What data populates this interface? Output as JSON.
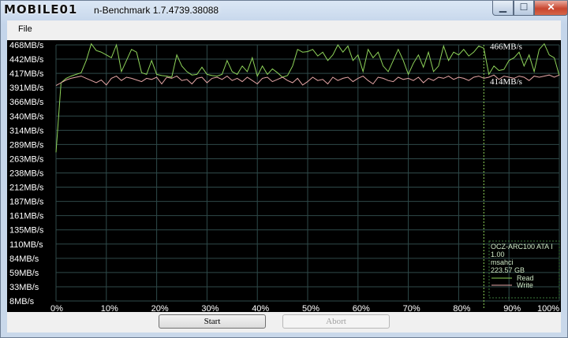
{
  "window": {
    "logo_text": "MOBILE01",
    "title": "n-Benchmark 1.7.4739.38088",
    "min_glyph": "▁",
    "max_glyph": "☐",
    "close_glyph": "✕"
  },
  "menu": {
    "file": "File"
  },
  "buttons": {
    "start": "Start",
    "abort": "Abort"
  },
  "device": {
    "lines": [
      "OCZ-ARC100 ATA I",
      "1.00",
      "msahci",
      "223.57 GB"
    ],
    "legend_read": "Read",
    "legend_write": "Write"
  },
  "chart_data": {
    "type": "line",
    "ylim": [
      8,
      468
    ],
    "y_ticks": [
      "468MB/s",
      "442MB/s",
      "417MB/s",
      "391MB/s",
      "366MB/s",
      "340MB/s",
      "314MB/s",
      "289MB/s",
      "263MB/s",
      "238MB/s",
      "212MB/s",
      "187MB/s",
      "161MB/s",
      "135MB/s",
      "110MB/s",
      "84MB/s",
      "59MB/s",
      "33MB/s",
      "8MB/s"
    ],
    "x_ticks": [
      "0%",
      "10%",
      "20%",
      "30%",
      "40%",
      "50%",
      "60%",
      "70%",
      "80%",
      "90%",
      "100%"
    ],
    "xlim": [
      0,
      100
    ],
    "grid": true,
    "progress_marker": 85,
    "series": [
      {
        "name": "Read",
        "color": "#8fd45a",
        "readout": "466MB/s",
        "x": [
          0,
          1,
          2,
          3,
          4,
          5,
          6,
          7,
          8,
          9,
          10,
          11,
          12,
          13,
          14,
          15,
          16,
          17,
          18,
          19,
          20,
          21,
          22,
          23,
          24,
          25,
          26,
          27,
          28,
          29,
          30,
          31,
          32,
          33,
          34,
          35,
          36,
          37,
          38,
          39,
          40,
          41,
          42,
          43,
          44,
          45,
          46,
          47,
          48,
          49,
          50,
          51,
          52,
          53,
          54,
          55,
          56,
          57,
          58,
          59,
          60,
          61,
          62,
          63,
          64,
          65,
          66,
          67,
          68,
          69,
          70,
          71,
          72,
          73,
          74,
          75,
          76,
          77,
          78,
          79,
          80,
          81,
          82,
          83,
          84,
          85,
          86,
          87,
          88,
          89,
          90,
          91,
          92,
          93,
          94,
          95,
          96,
          97,
          98,
          99,
          100
        ],
        "y": [
          275,
          400,
          408,
          412,
          415,
          418,
          440,
          470,
          458,
          455,
          450,
          445,
          468,
          420,
          440,
          460,
          455,
          418,
          415,
          440,
          415,
          413,
          412,
          410,
          450,
          430,
          420,
          414,
          415,
          428,
          415,
          413,
          412,
          415,
          440,
          420,
          415,
          430,
          420,
          445,
          412,
          430,
          415,
          425,
          418,
          410,
          413,
          430,
          460,
          455,
          456,
          460,
          448,
          455,
          440,
          450,
          468,
          455,
          466,
          440,
          450,
          420,
          460,
          445,
          455,
          430,
          420,
          440,
          460,
          440,
          415,
          435,
          450,
          428,
          455,
          420,
          430,
          466,
          440,
          455,
          450,
          460,
          448,
          455,
          466,
          462,
          415,
          430,
          422,
          424,
          440,
          445,
          455,
          430,
          450,
          420,
          460,
          470,
          450,
          445,
          413
        ]
      },
      {
        "name": "Write",
        "color": "#e6a7a7",
        "readout": "414MB/s",
        "x": [
          0,
          1,
          2,
          3,
          4,
          5,
          6,
          7,
          8,
          9,
          10,
          11,
          12,
          13,
          14,
          15,
          16,
          17,
          18,
          19,
          20,
          21,
          22,
          23,
          24,
          25,
          26,
          27,
          28,
          29,
          30,
          31,
          32,
          33,
          34,
          35,
          36,
          37,
          38,
          39,
          40,
          41,
          42,
          43,
          44,
          45,
          46,
          47,
          48,
          49,
          50,
          51,
          52,
          53,
          54,
          55,
          56,
          57,
          58,
          59,
          60,
          61,
          62,
          63,
          64,
          65,
          66,
          67,
          68,
          69,
          70,
          71,
          72,
          73,
          74,
          75,
          76,
          77,
          78,
          79,
          80,
          81,
          82,
          83,
          84,
          85,
          86,
          87,
          88,
          89,
          90,
          91,
          92,
          93,
          94,
          95,
          96,
          97,
          98,
          99,
          100
        ],
        "y": [
          395,
          400,
          405,
          408,
          410,
          412,
          408,
          404,
          400,
          405,
          396,
          408,
          412,
          404,
          410,
          408,
          405,
          402,
          408,
          406,
          410,
          398,
          410,
          408,
          412,
          404,
          406,
          398,
          408,
          410,
          400,
          408,
          410,
          406,
          412,
          404,
          408,
          402,
          410,
          404,
          398,
          408,
          410,
          402,
          406,
          410,
          404,
          400,
          408,
          396,
          402,
          410,
          404,
          406,
          398,
          410,
          404,
          408,
          410,
          402,
          408,
          412,
          404,
          398,
          410,
          408,
          404,
          402,
          410,
          406,
          408,
          404,
          410,
          400,
          408,
          404,
          410,
          408,
          412,
          406,
          410,
          408,
          404,
          410,
          412,
          408,
          410,
          414,
          406,
          412,
          410,
          408,
          412,
          410,
          404,
          412,
          410,
          412,
          414,
          410,
          414
        ]
      }
    ]
  }
}
